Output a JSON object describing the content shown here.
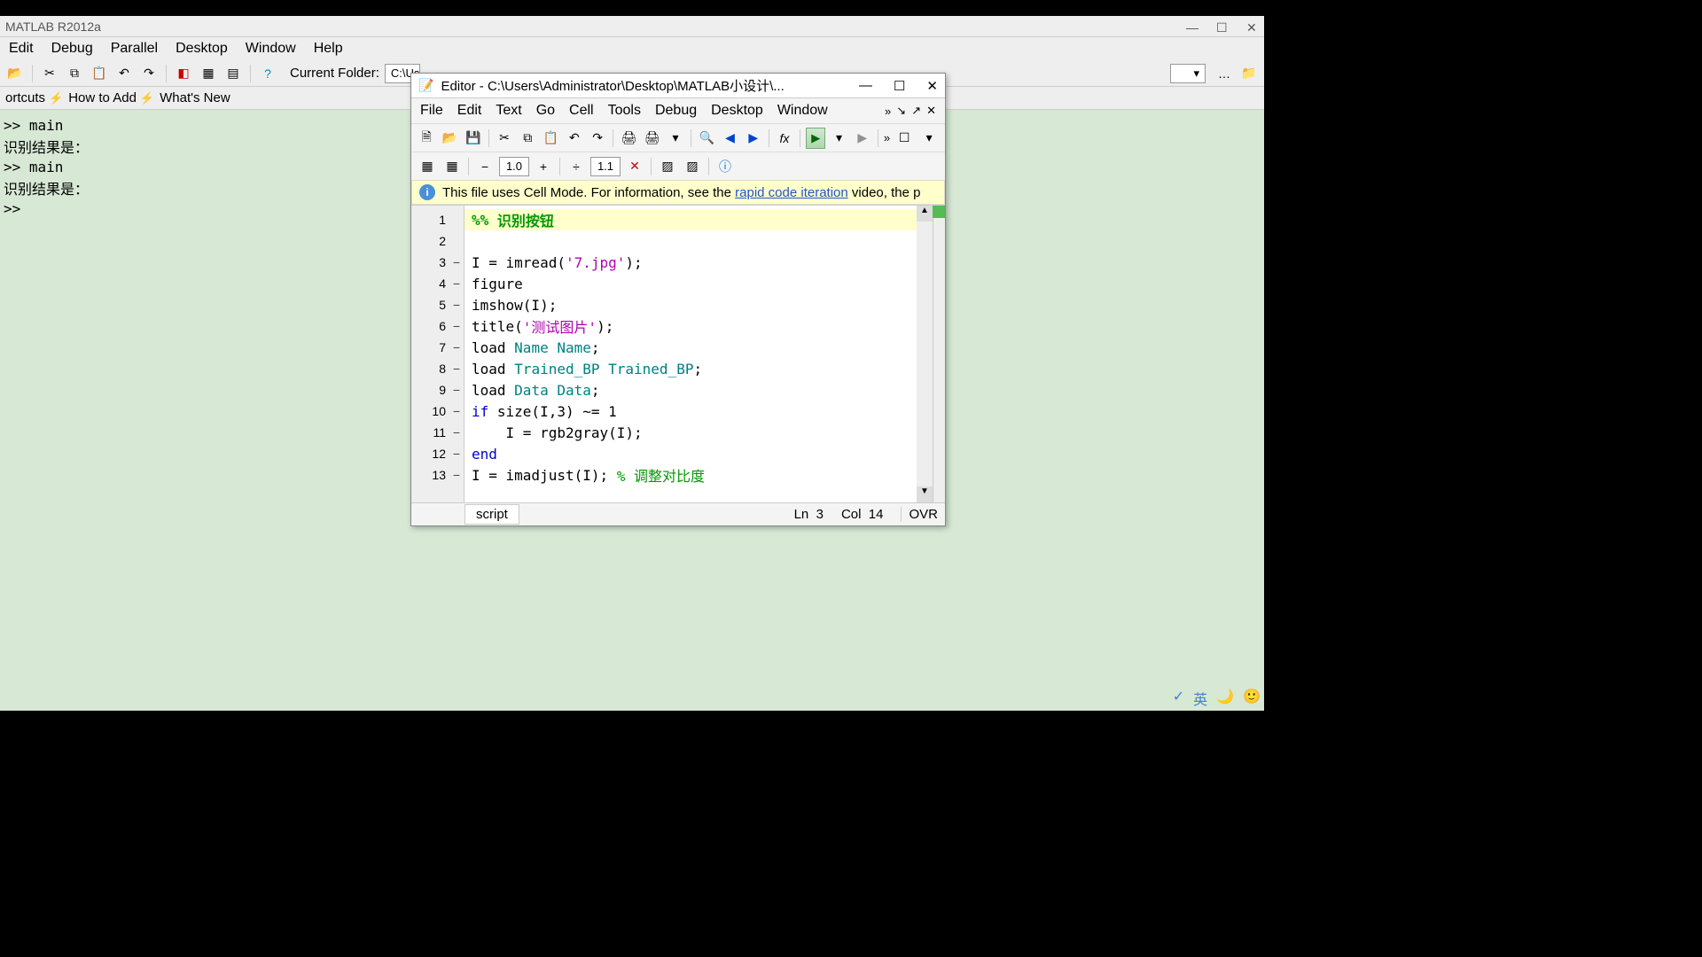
{
  "app_title": "MATLAB R2012a",
  "main_menu": [
    "Edit",
    "Debug",
    "Parallel",
    "Desktop",
    "Window",
    "Help"
  ],
  "current_folder_label": "Current Folder:",
  "current_folder_value": "C:\\Us",
  "shortcuts": {
    "howto": "How to Add",
    "whatsnew": "What's New"
  },
  "cmdlines": [
    ">> main",
    "识别结果是：",
    "",
    ">> main",
    "识别结果是：",
    "",
    ">>"
  ],
  "editor": {
    "title": "Editor - C:\\Users\\Administrator\\Desktop\\MATLAB小设计\\...",
    "menu": [
      "File",
      "Edit",
      "Text",
      "Go",
      "Cell",
      "Tools",
      "Debug",
      "Desktop",
      "Window"
    ],
    "spin1": "1.0",
    "spin2": "1.1",
    "info_pre": "This file uses Cell Mode. For information, see the ",
    "info_link": "rapid code iteration",
    "info_post": " video, the p",
    "code": [
      {
        "n": 1,
        "dash": false,
        "tokens": [
          {
            "t": "%%",
            "c": "sectmark"
          },
          {
            "t": " 识别按钮",
            "c": "secttitle"
          }
        ],
        "cellhdr": true
      },
      {
        "n": 2,
        "dash": false,
        "tokens": []
      },
      {
        "n": 3,
        "dash": true,
        "tokens": [
          {
            "t": "I = imread(",
            "c": ""
          },
          {
            "t": "'7.jpg'",
            "c": "str"
          },
          {
            "t": ");",
            "c": ""
          }
        ]
      },
      {
        "n": 4,
        "dash": true,
        "tokens": [
          {
            "t": "figure",
            "c": ""
          }
        ]
      },
      {
        "n": 5,
        "dash": true,
        "tokens": [
          {
            "t": "imshow(I);",
            "c": ""
          }
        ]
      },
      {
        "n": 6,
        "dash": true,
        "tokens": [
          {
            "t": "title(",
            "c": ""
          },
          {
            "t": "'测试图片'",
            "c": "str"
          },
          {
            "t": ");",
            "c": ""
          }
        ]
      },
      {
        "n": 7,
        "dash": true,
        "tokens": [
          {
            "t": "load ",
            "c": ""
          },
          {
            "t": "Name Name",
            "c": "var"
          },
          {
            "t": ";",
            "c": ""
          }
        ]
      },
      {
        "n": 8,
        "dash": true,
        "tokens": [
          {
            "t": "load ",
            "c": ""
          },
          {
            "t": "Trained_BP Trained_BP",
            "c": "var"
          },
          {
            "t": ";",
            "c": ""
          }
        ]
      },
      {
        "n": 9,
        "dash": true,
        "tokens": [
          {
            "t": "load ",
            "c": ""
          },
          {
            "t": "Data Data",
            "c": "var"
          },
          {
            "t": ";",
            "c": ""
          }
        ]
      },
      {
        "n": 10,
        "dash": true,
        "tokens": [
          {
            "t": "if",
            "c": "kw"
          },
          {
            "t": " size(I,3) ~= 1",
            "c": ""
          }
        ]
      },
      {
        "n": 11,
        "dash": true,
        "tokens": [
          {
            "t": "    I = rgb2gray(I);",
            "c": ""
          }
        ]
      },
      {
        "n": 12,
        "dash": true,
        "tokens": [
          {
            "t": "end",
            "c": "kw"
          }
        ]
      },
      {
        "n": 13,
        "dash": true,
        "tokens": [
          {
            "t": "I = imadjust(I); ",
            "c": ""
          },
          {
            "t": "% 调整对比度",
            "c": "comment"
          }
        ]
      }
    ],
    "tabname": "script",
    "ln_lbl": "Ln",
    "ln_val": "3",
    "col_lbl": "Col",
    "col_val": "14",
    "ovr": "OVR"
  },
  "ime": [
    "✓",
    "英",
    "🌙",
    "🙂"
  ]
}
